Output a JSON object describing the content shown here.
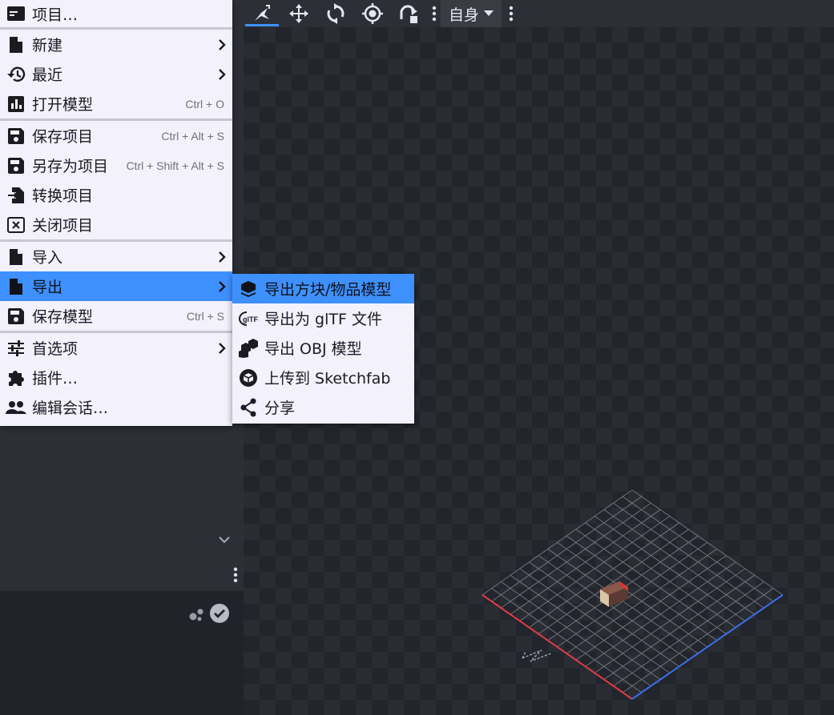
{
  "toolbar": {
    "tools": [
      {
        "name": "pivot-tool-icon",
        "active": true
      },
      {
        "name": "move-tool-icon",
        "active": false
      },
      {
        "name": "rotate-tool-icon",
        "active": false
      },
      {
        "name": "origin-tool-icon",
        "active": false
      },
      {
        "name": "vertex-snap-icon",
        "active": false
      }
    ],
    "space_label": "自身"
  },
  "file_menu": {
    "project": "项目…",
    "new": "新建",
    "recent": "最近",
    "open_model": "打开模型",
    "open_model_shortcut": "Ctrl + O",
    "save_project": "保存项目",
    "save_project_shortcut": "Ctrl + Alt + S",
    "save_project_as": "另存为项目",
    "save_project_as_shortcut": "Ctrl + Shift + Alt + S",
    "convert_project": "转换项目",
    "close_project": "关闭项目",
    "import": "导入",
    "export": "导出",
    "save_model": "保存模型",
    "save_model_shortcut": "Ctrl + S",
    "settings": "首选项",
    "plugins": "插件…",
    "edit_session": "编辑会话…"
  },
  "export_menu": {
    "block_item": "导出方块/物品模型",
    "gltf": "导出为 glTF 文件",
    "obj": "导出 OBJ 模型",
    "sketchfab": "上传到 Sketchfab",
    "share": "分享",
    "gltf_logo_text": "glTF"
  },
  "colors": {
    "accent": "#3e90ff",
    "menu_bg": "#f3f1fb",
    "panel_bg": "#2d2f37",
    "axis_x": "#e03c46",
    "axis_z": "#3a6ee6"
  }
}
